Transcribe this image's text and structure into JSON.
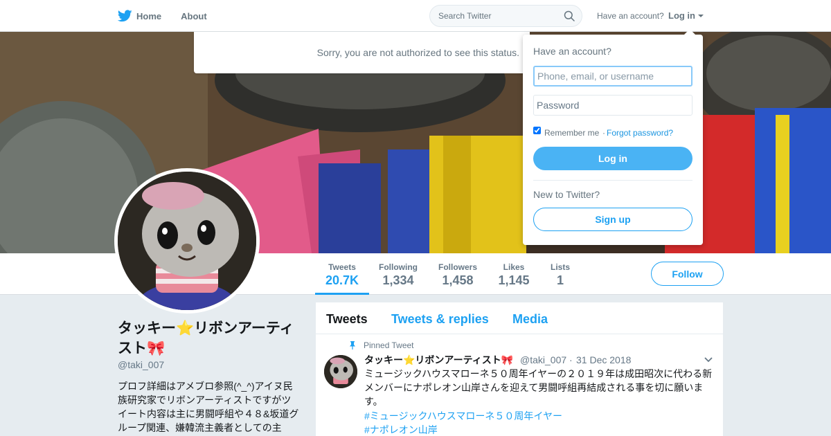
{
  "nav": {
    "home": "Home",
    "about": "About",
    "search_placeholder": "Search Twitter",
    "have_account": "Have an account?",
    "login": "Log in"
  },
  "alert": {
    "text": "Sorry, you are not authorized to see this status."
  },
  "profile": {
    "name": "タッキー⭐リボンアーティスト🎀",
    "handle": "@taki_007",
    "bio": "プロフ詳細はアメブロ参照(^_^)アイヌ民族研究家でリボンアーティストですがツイート内容は主に男闘呼組や４８&坂道グループ関連、嫌韓流主義者としての主"
  },
  "stats": [
    {
      "label": "Tweets",
      "value": "20.7K"
    },
    {
      "label": "Following",
      "value": "1,334"
    },
    {
      "label": "Followers",
      "value": "1,458"
    },
    {
      "label": "Likes",
      "value": "1,145"
    },
    {
      "label": "Lists",
      "value": "1"
    }
  ],
  "follow_label": "Follow",
  "timeline": {
    "tabs": [
      "Tweets",
      "Tweets & replies",
      "Media"
    ],
    "pinned_label": "Pinned Tweet",
    "tweet": {
      "name": "タッキー⭐リボンアーティスト🎀",
      "handle": "@taki_007",
      "separator": "·",
      "date": "31 Dec 2018",
      "text": "ミュージックハウスマローネ５０周年イヤーの２０１９年は成田昭次に代わる新メンバーにナポレオン山岸さんを迎えて男闘呼組再結成される事を切に願います。",
      "hashtags": [
        "#ミュージックハウスマローネ５０周年イヤー",
        "#ナポレオン山岸"
      ]
    }
  },
  "login_dropdown": {
    "title": "Have an account?",
    "username_placeholder": "Phone, email, or username",
    "password_placeholder": "Password",
    "remember_me": "Remember me",
    "separator": "·",
    "forgot": "Forgot password?",
    "login_button": "Log in",
    "new_to_twitter": "New to Twitter?",
    "signup_button": "Sign up"
  },
  "colors": {
    "accent": "#1da1f2",
    "login_button": "#4ab3f4",
    "background": "#e6ecf0"
  },
  "icons": [
    "twitter-bird-icon",
    "search-icon",
    "caret-down-icon",
    "pin-icon",
    "chevron-down-icon"
  ]
}
